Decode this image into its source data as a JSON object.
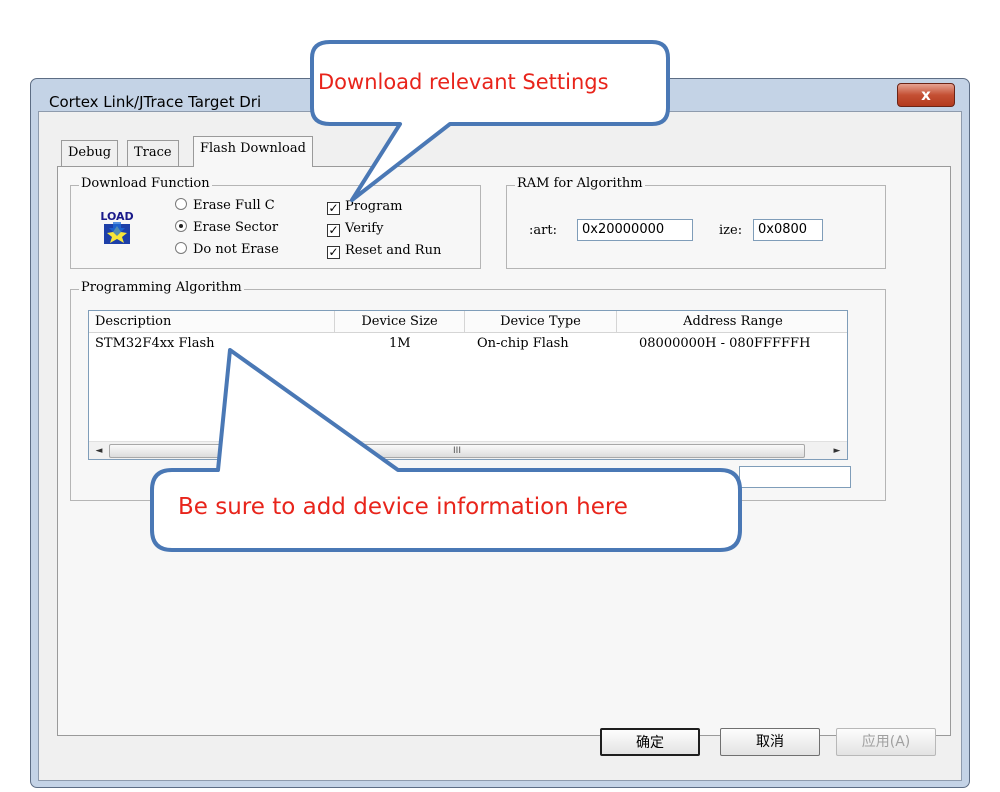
{
  "window": {
    "title": "Cortex  Link/JTrace Target Dri",
    "close_glyph": "x"
  },
  "tabs": [
    "Debug",
    "Trace",
    "Flash Download"
  ],
  "download_function": {
    "legend": "Download Function",
    "icon_label": "LOAD",
    "radios": [
      {
        "label": "Erase Full C",
        "checked": false
      },
      {
        "label": "Erase Sector",
        "checked": true
      },
      {
        "label": "Do not Erase",
        "checked": false
      }
    ],
    "checks": [
      {
        "label": "Program",
        "checked": true
      },
      {
        "label": "Verify",
        "checked": true
      },
      {
        "label": "Reset and Run",
        "checked": true
      }
    ],
    "check_mark": "✓"
  },
  "ram": {
    "legend": "RAM for Algorithm",
    "start_label": ":art:",
    "start_value": "0x20000000",
    "size_label": "ize:",
    "size_value": "0x0800"
  },
  "algorithm": {
    "legend": "Programming Algorithm",
    "columns": [
      "Description",
      "Device Size",
      "Device Type",
      "Address Range"
    ],
    "rows": [
      [
        "STM32F4xx Flash",
        "1M",
        "On-chip Flash",
        "08000000H - 080FFFFFH"
      ]
    ],
    "scroll_thumb_glyph": "III",
    "scroll_left": "◄",
    "scroll_right": "►",
    "obscured_label_tail": ":"
  },
  "buttons": {
    "ok": "确定",
    "cancel": "取消",
    "apply": "应用(A)"
  },
  "callouts": {
    "top": "Download relevant Settings",
    "bottom": "Be sure to add device information here"
  },
  "colors": {
    "callout_border": "#4a78b5",
    "callout_text": "#e8241b"
  }
}
